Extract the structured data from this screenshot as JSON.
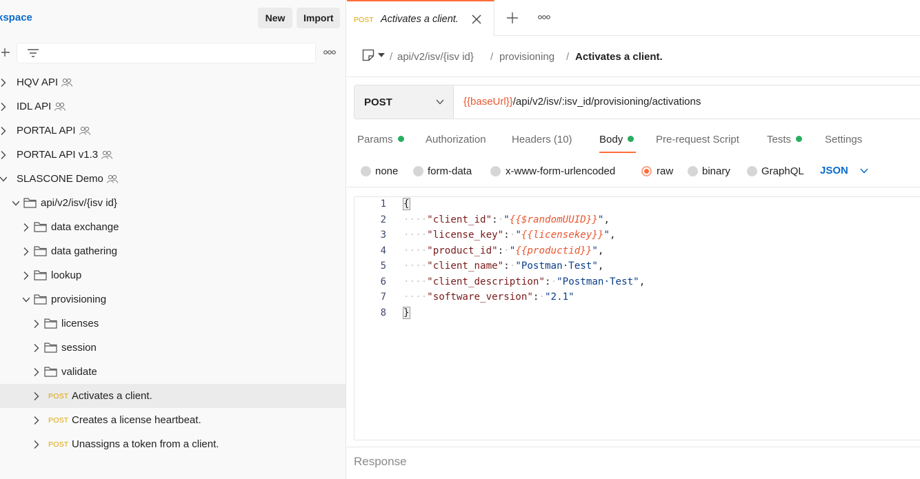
{
  "workspace": {
    "title": "kspace",
    "new_label": "New",
    "import_label": "Import",
    "filter_placeholder": ""
  },
  "tree": [
    {
      "label": "HQV API",
      "type": "collection",
      "team": true,
      "depth": 0,
      "expanded": false
    },
    {
      "label": "IDL API",
      "type": "collection",
      "team": true,
      "depth": 0,
      "expanded": false
    },
    {
      "label": "PORTAL API",
      "type": "collection",
      "team": true,
      "depth": 0,
      "expanded": false
    },
    {
      "label": "PORTAL API v1.3",
      "type": "collection",
      "team": true,
      "depth": 0,
      "expanded": false
    },
    {
      "label": "SLASCONE Demo",
      "type": "collection",
      "team": true,
      "depth": 0,
      "expanded": true
    },
    {
      "label": "api/v2/isv/{isv id}",
      "type": "folder",
      "depth": 1,
      "expanded": true
    },
    {
      "label": "data exchange",
      "type": "folder",
      "depth": 2,
      "expanded": false
    },
    {
      "label": "data gathering",
      "type": "folder",
      "depth": 2,
      "expanded": false
    },
    {
      "label": "lookup",
      "type": "folder",
      "depth": 2,
      "expanded": false
    },
    {
      "label": "provisioning",
      "type": "folder",
      "depth": 2,
      "expanded": true
    },
    {
      "label": "licenses",
      "type": "folder",
      "depth": 3,
      "expanded": false
    },
    {
      "label": "session",
      "type": "folder",
      "depth": 3,
      "expanded": false
    },
    {
      "label": "validate",
      "type": "folder",
      "depth": 3,
      "expanded": false
    },
    {
      "label": "Activates a client.",
      "type": "request",
      "method": "POST",
      "depth": 3,
      "selected": true
    },
    {
      "label": "Creates a license heartbeat.",
      "type": "request",
      "method": "POST",
      "depth": 3
    },
    {
      "label": "Unassigns a token from a client.",
      "type": "request",
      "method": "POST",
      "depth": 3
    }
  ],
  "tab": {
    "method": "POST",
    "name": "Activates a client."
  },
  "breadcrumb": {
    "parts": [
      "api/v2/isv/{isv id}",
      "provisioning"
    ],
    "separator": "/",
    "current": "Activates a client."
  },
  "request": {
    "method": "POST",
    "url_var": "{{baseUrl}}",
    "url_rest": "/api/v2/isv/:isv_id/provisioning/activations"
  },
  "request_tabs": {
    "params": "Params",
    "authorization": "Authorization",
    "headers": "Headers",
    "headers_count": "(10)",
    "body": "Body",
    "prerequest": "Pre-request Script",
    "tests": "Tests",
    "settings": "Settings"
  },
  "body_types": {
    "none": "none",
    "form_data": "form-data",
    "urlencoded": "x-www-form-urlencoded",
    "raw": "raw",
    "binary": "binary",
    "graphql": "GraphQL",
    "format": "JSON"
  },
  "editor": {
    "line_numbers": [
      "1",
      "2",
      "3",
      "4",
      "5",
      "6",
      "7",
      "8"
    ],
    "open_brace": "{",
    "close_brace": "}",
    "lines": [
      {
        "key": "\"client_id\"",
        "value": "{{$randomUUID}}",
        "is_var": true,
        "comma": ","
      },
      {
        "key": "\"license_key\"",
        "value": "{{licensekey}}",
        "is_var": true,
        "comma": ","
      },
      {
        "key": "\"product_id\"",
        "value": "{{productid}}",
        "is_var": true,
        "comma": ","
      },
      {
        "key": "\"client_name\"",
        "value": "\"Postman·Test\"",
        "is_var": false,
        "comma": ","
      },
      {
        "key": "\"client_description\"",
        "value": "\"Postman·Test\"",
        "is_var": false,
        "comma": ","
      },
      {
        "key": "\"software_version\"",
        "value": "\"2.1\"",
        "is_var": false,
        "comma": ""
      }
    ]
  },
  "response": {
    "label": "Response"
  }
}
